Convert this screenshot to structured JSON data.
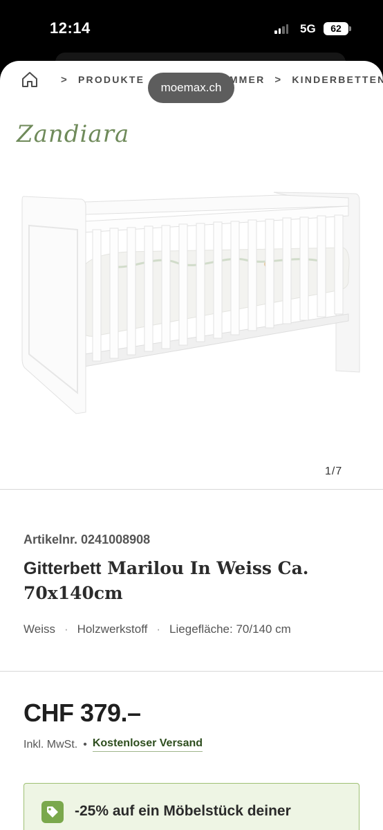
{
  "status_bar": {
    "time": "12:14",
    "network": "5G",
    "battery": "62"
  },
  "browser": {
    "url": "moemax.ch"
  },
  "breadcrumb": {
    "items": [
      "PRODUKTE",
      "KINDERZIMMER",
      "KINDERBETTEN"
    ]
  },
  "product": {
    "brand": "Zandiara",
    "image_counter": "1/7",
    "article_number": "Artikelnr. 0241008908",
    "title_bold": "Gitterbett",
    "title_rest": "Marilou In Weiss Ca. 70x140cm",
    "attributes": [
      "Weiss",
      "Holzwerkstoff",
      "Liegefläche: 70/140 cm"
    ],
    "attribute_separator": "·",
    "price": "CHF 379.–",
    "tax_note": "Inkl. MwSt.",
    "tax_separator": "•",
    "shipping": "Kostenloser Versand"
  },
  "promo": {
    "text": "-25% auf ein Möbelstück deiner",
    "icon": "tag-icon",
    "accent_color": "#7aa84c"
  },
  "colors": {
    "brand_green": "#6f8a5a",
    "link_green": "#2d4d1e"
  }
}
